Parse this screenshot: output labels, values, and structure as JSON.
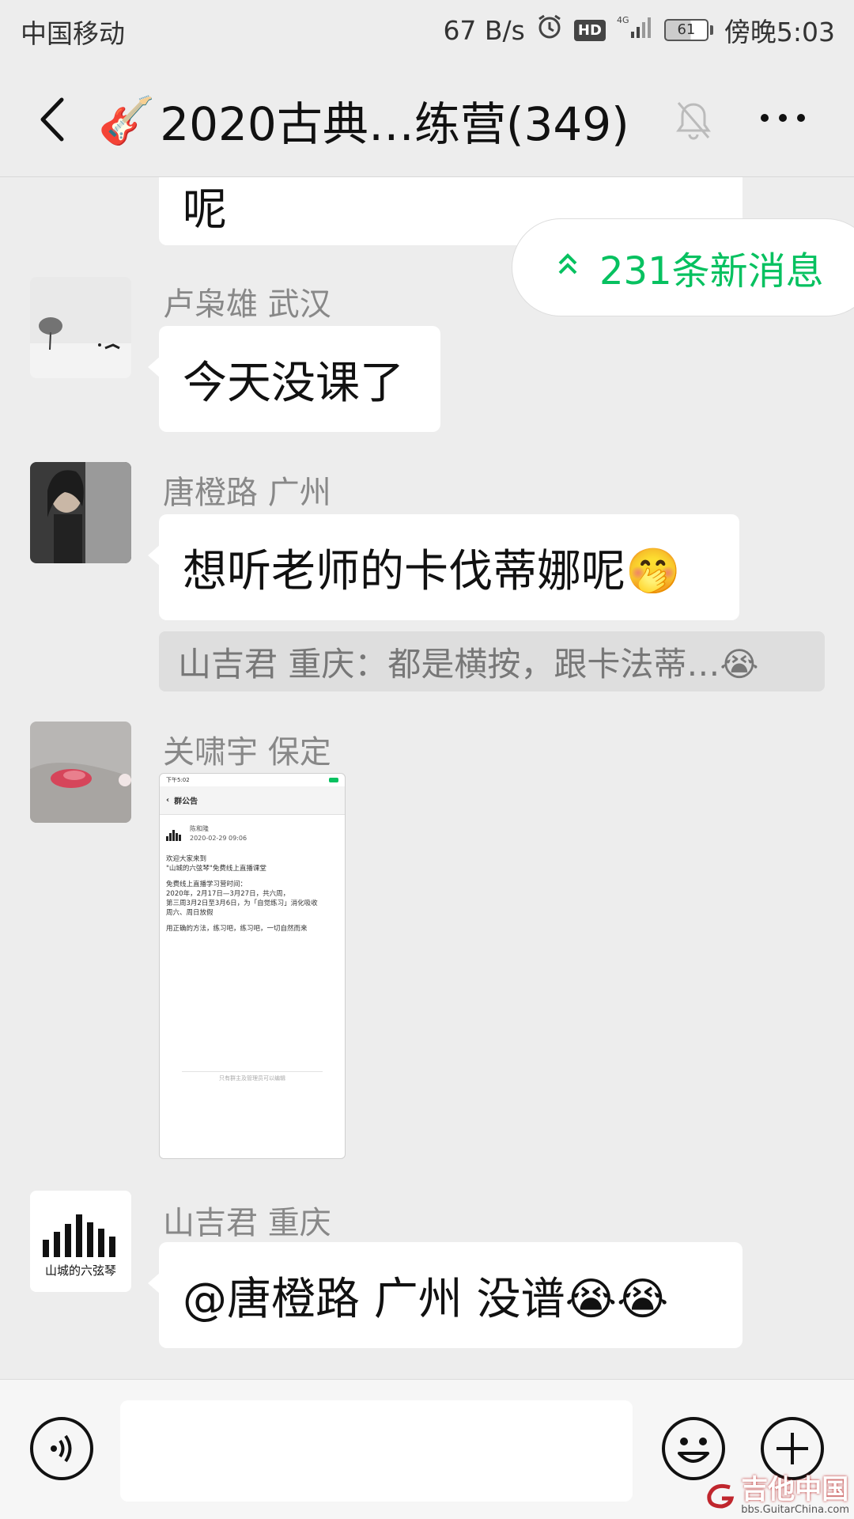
{
  "status_bar": {
    "carrier": "中国移动",
    "net_speed": "67 B/s",
    "hd": "HD",
    "network": "4G",
    "battery": "61",
    "battery_level": 0.61,
    "time": "傍晚5:03"
  },
  "header": {
    "title_emoji": "🎸",
    "title": "2020古典…练营(349)",
    "icons": [
      "back-arrow-icon",
      "mute-bell-icon",
      "more-dots-icon"
    ]
  },
  "new_messages": {
    "label": "231条新消息"
  },
  "messages": [
    {
      "text": "呢"
    },
    {
      "sender": "卢枭雄 武汉",
      "text": "今天没课了"
    },
    {
      "sender": "唐橙路  广州",
      "text": "想听老师的卡伐蒂娜呢🤭",
      "quote": "山吉君 重庆：都是横按，跟卡法蒂…😭"
    },
    {
      "sender": "关啸宇 保定",
      "image": {
        "status_time": "下午5:02",
        "header": "群公告",
        "author": "陈和隆",
        "date": "2020-02-29 09:06",
        "lines": [
          "欢迎大家来到",
          "\"山城的六弦琴\"免费线上直播课堂",
          "免费线上直播学习营时间：",
          "2020年，2月17日—3月27日，共六周，",
          "第三周3月2日至3月6日，为「自觉练习」消化吸收",
          "周六、周日放假",
          "用正确的方法，练习吧，练习吧，一切自然而来"
        ],
        "footer": "只有群主及管理员可以编辑"
      }
    },
    {
      "sender": "山吉君 重庆",
      "text": "@唐橙路  广州  没谱😭😭",
      "avatar_label": "山城的六弦琴"
    }
  ],
  "input": {
    "value": ""
  },
  "watermark": {
    "name": "吉他中国",
    "url": "bbs.GuitarChina.com"
  },
  "colors": {
    "accent_green": "#07c160",
    "background": "#ededed",
    "bubble": "#ffffff"
  }
}
